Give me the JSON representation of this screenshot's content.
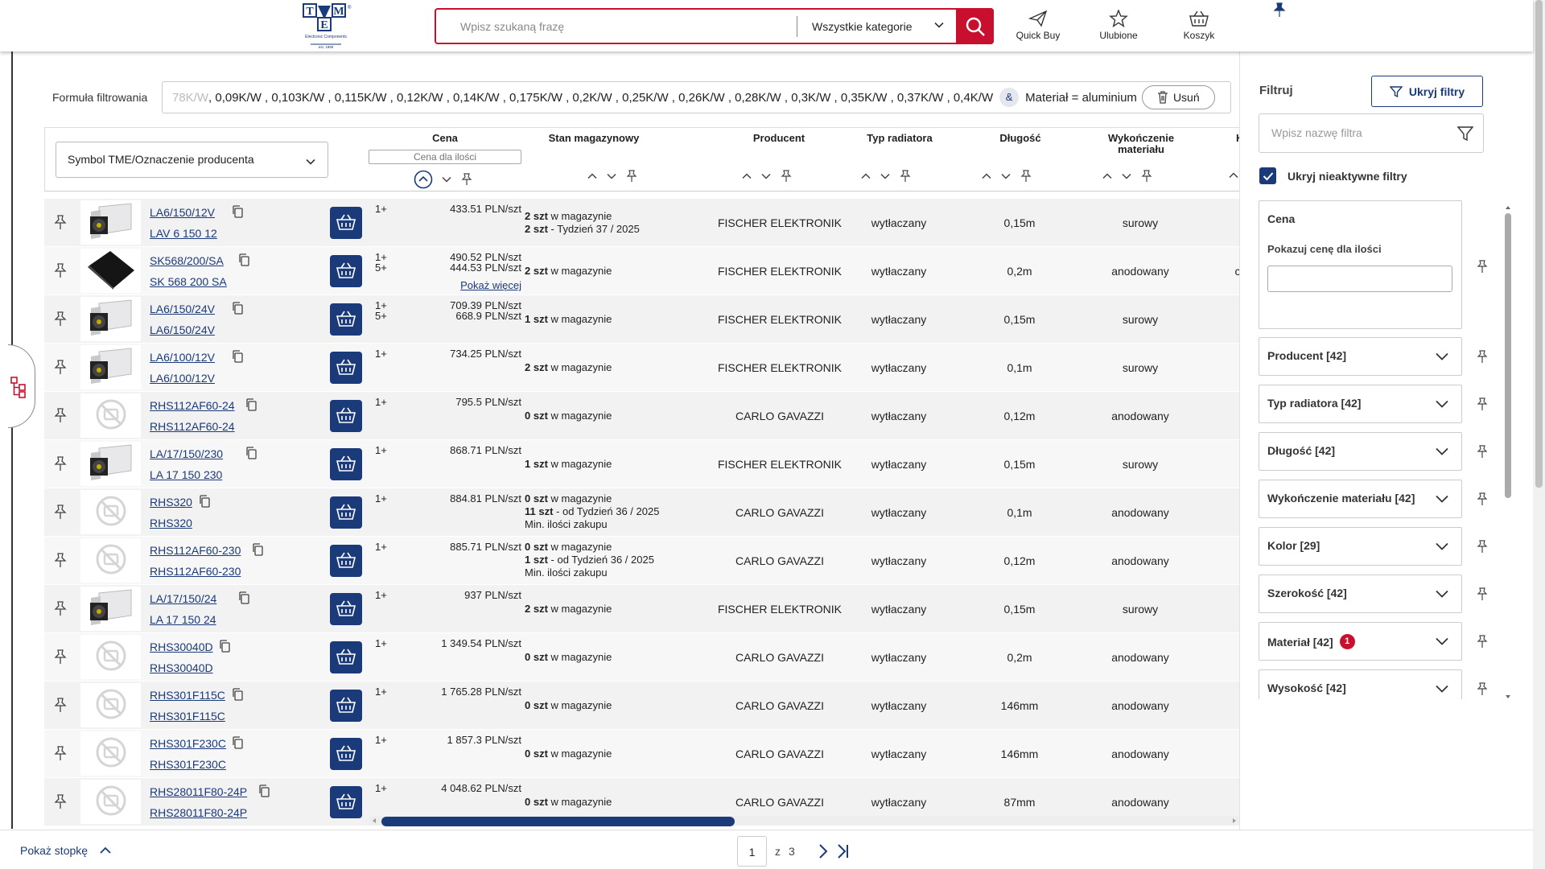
{
  "header": {
    "search_placeholder": "Wpisz szukaną frazę",
    "category": "Wszystkie kategorie",
    "quick_buy": "Quick Buy",
    "favorites": "Ulubione",
    "cart": "Koszyk"
  },
  "filter": {
    "label": "Formuła filtrowania",
    "formula_faded": "78K/W ",
    "formula": ", 0,09K/W , 0,103K/W , 0,115K/W , 0,12K/W , 0,14K/W , 0,175K/W , 0,2K/W , 0,25K/W , 0,26K/W , 0,28K/W , 0,3K/W , 0,35K/W , 0,37K/W , 0,4K/W",
    "amp": "&",
    "material": "Materiał = aluminium",
    "delete": "Usuń"
  },
  "table": {
    "symbol_select": "Symbol TME/Oznaczenie producenta",
    "headers": {
      "price": "Cena",
      "qty_placeholder": "Cena dla ilości",
      "stock": "Stan magazynowy",
      "producer": "Producent",
      "type": "Typ radiatora",
      "length": "Długość",
      "finish1": "Wykończenie",
      "finish2": "materiału",
      "next": "K"
    },
    "rows": [
      {
        "sym1": "LA6/150/12V",
        "sym2": "LAV 6 150 12",
        "img": "photo-fan",
        "pq": [
          "1+"
        ],
        "pp": [
          "433.51 PLN/szt"
        ],
        "more": "",
        "stock": [
          [
            "2 szt",
            " w magazynie"
          ],
          [
            "2 szt",
            " -  Tydzień 37 / 2025"
          ]
        ],
        "producer": "FISCHER ELEKTRONIK",
        "type": "wytłaczany",
        "length": "0,15m",
        "finish": "surowy",
        "extra": ""
      },
      {
        "sym1": "SK568/200/SA",
        "sym2": "SK 568 200 SA",
        "img": "photo-black",
        "pq": [
          "1+",
          "5+"
        ],
        "pp": [
          "490.52 PLN/szt",
          "444.53 PLN/szt"
        ],
        "more": "Pokaż więcej",
        "stock": [
          [
            "2 szt",
            " w magazynie"
          ]
        ],
        "producer": "FISCHER ELEKTRONIK",
        "type": "wytłaczany",
        "length": "0,2m",
        "finish": "anodowany",
        "extra": "c"
      },
      {
        "sym1": "LA6/150/24V",
        "sym2": "LA6/150/24V",
        "img": "photo-fan",
        "pq": [
          "1+",
          "5+"
        ],
        "pp": [
          "709.39 PLN/szt",
          "668.9 PLN/szt"
        ],
        "more": "",
        "stock": [
          [
            "1 szt",
            " w magazynie"
          ]
        ],
        "producer": "FISCHER ELEKTRONIK",
        "type": "wytłaczany",
        "length": "0,15m",
        "finish": "surowy",
        "extra": ""
      },
      {
        "sym1": "LA6/100/12V",
        "sym2": "LA6/100/12V",
        "img": "photo-fan",
        "pq": [
          "1+"
        ],
        "pp": [
          "734.25 PLN/szt"
        ],
        "more": "",
        "stock": [
          [
            "2 szt",
            " w magazynie"
          ]
        ],
        "producer": "FISCHER ELEKTRONIK",
        "type": "wytłaczany",
        "length": "0,1m",
        "finish": "surowy",
        "extra": ""
      },
      {
        "sym1": "RHS112AF60-24",
        "sym2": "RHS112AF60-24",
        "img": "no-image",
        "pq": [
          "1+"
        ],
        "pp": [
          "795.5 PLN/szt"
        ],
        "more": "",
        "stock": [
          [
            "0 szt",
            " w magazynie"
          ]
        ],
        "producer": "CARLO GAVAZZI",
        "type": "wytłaczany",
        "length": "0,12m",
        "finish": "anodowany",
        "extra": ""
      },
      {
        "sym1": "LA/17/150/230",
        "sym2": "LA 17 150 230",
        "img": "photo-fan",
        "pq": [
          "1+"
        ],
        "pp": [
          "868.71 PLN/szt"
        ],
        "more": "",
        "stock": [
          [
            "1 szt",
            " w magazynie"
          ]
        ],
        "producer": "FISCHER ELEKTRONIK",
        "type": "wytłaczany",
        "length": "0,15m",
        "finish": "surowy",
        "extra": ""
      },
      {
        "sym1": "RHS320",
        "sym2": "RHS320",
        "img": "no-image",
        "pq": [
          "1+"
        ],
        "pp": [
          "884.81 PLN/szt"
        ],
        "more": "",
        "stock": [
          [
            "0 szt",
            " w magazynie"
          ],
          [
            "11 szt",
            " - od Tydzień 36 / 2025"
          ],
          [
            "",
            "Min. ilości zakupu"
          ]
        ],
        "producer": "CARLO GAVAZZI",
        "type": "wytłaczany",
        "length": "0,1m",
        "finish": "anodowany",
        "extra": ""
      },
      {
        "sym1": "RHS112AF60-230",
        "sym2": "RHS112AF60-230",
        "img": "no-image",
        "pq": [
          "1+"
        ],
        "pp": [
          "885.71 PLN/szt"
        ],
        "more": "",
        "stock": [
          [
            "0 szt",
            " w magazynie"
          ],
          [
            "1 szt",
            " - od Tydzień 36 / 2025"
          ],
          [
            "",
            "Min. ilości zakupu"
          ]
        ],
        "producer": "CARLO GAVAZZI",
        "type": "wytłaczany",
        "length": "0,12m",
        "finish": "anodowany",
        "extra": ""
      },
      {
        "sym1": "LA/17/150/24",
        "sym2": "LA 17 150 24",
        "img": "photo-fan",
        "pq": [
          "1+"
        ],
        "pp": [
          "937 PLN/szt"
        ],
        "more": "",
        "stock": [
          [
            "2 szt",
            " w magazynie"
          ]
        ],
        "producer": "FISCHER ELEKTRONIK",
        "type": "wytłaczany",
        "length": "0,15m",
        "finish": "surowy",
        "extra": ""
      },
      {
        "sym1": "RHS30040D",
        "sym2": "RHS30040D",
        "img": "no-image",
        "pq": [
          "1+"
        ],
        "pp": [
          "1 349.54 PLN/szt"
        ],
        "more": "",
        "stock": [
          [
            "0 szt",
            " w magazynie"
          ]
        ],
        "producer": "CARLO GAVAZZI",
        "type": "wytłaczany",
        "length": "0,2m",
        "finish": "anodowany",
        "extra": ""
      },
      {
        "sym1": "RHS301F115C",
        "sym2": "RHS301F115C",
        "img": "no-image",
        "pq": [
          "1+"
        ],
        "pp": [
          "1 765.28 PLN/szt"
        ],
        "more": "",
        "stock": [
          [
            "0 szt",
            " w magazynie"
          ]
        ],
        "producer": "CARLO GAVAZZI",
        "type": "wytłaczany",
        "length": "146mm",
        "finish": "anodowany",
        "extra": ""
      },
      {
        "sym1": "RHS301F230C",
        "sym2": "RHS301F230C",
        "img": "no-image",
        "pq": [
          "1+"
        ],
        "pp": [
          "1 857.3 PLN/szt"
        ],
        "more": "",
        "stock": [
          [
            "0 szt",
            " w magazynie"
          ]
        ],
        "producer": "CARLO GAVAZZI",
        "type": "wytłaczany",
        "length": "146mm",
        "finish": "anodowany",
        "extra": ""
      },
      {
        "sym1": "RHS28011F80-24P",
        "sym2": "RHS28011F80-24P",
        "img": "no-image",
        "pq": [
          "1+"
        ],
        "pp": [
          "4 048.62 PLN/szt"
        ],
        "more": "",
        "stock": [
          [
            "0 szt",
            " w magazynie"
          ]
        ],
        "producer": "CARLO GAVAZZI",
        "type": "wytłaczany",
        "length": "87mm",
        "finish": "anodowany",
        "extra": ""
      }
    ]
  },
  "footer": {
    "show_footer": "Pokaż stopkę",
    "page": "1",
    "of": "z",
    "total": "3"
  },
  "right_panel": {
    "title": "Filtruj",
    "hide_filters": "Ukryj filtry",
    "filter_search_placeholder": "Wpisz nazwę filtra",
    "hide_inactive": "Ukryj nieaktywne filtry",
    "price_card": {
      "title": "Cena",
      "subtitle": "Pokazuj cenę dla ilości"
    },
    "filters": [
      {
        "label": "Producent [42]",
        "badge": ""
      },
      {
        "label": "Typ radiatora [42]",
        "badge": ""
      },
      {
        "label": "Długość [42]",
        "badge": ""
      },
      {
        "label": "Wykończenie materiału [42]",
        "badge": ""
      },
      {
        "label": "Kolor [29]",
        "badge": ""
      },
      {
        "label": "Szerokość [42]",
        "badge": ""
      },
      {
        "label": "Materiał [42]",
        "badge": "1"
      },
      {
        "label": "Wysokość [42]",
        "badge": ""
      }
    ]
  },
  "colors": {
    "brand_red": "#c8102e",
    "brand_navy": "#1a3a7a"
  }
}
